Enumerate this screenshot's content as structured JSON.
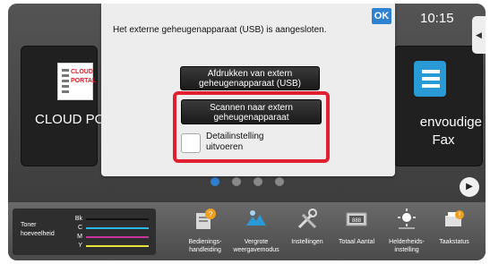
{
  "status": {
    "time": "10:15"
  },
  "home": {
    "tiles": [
      {
        "label": "CLOUD POR",
        "logo_text_1": "CLOUD",
        "logo_text_2": "PORTAL"
      },
      {
        "label": "envoudige Fax"
      }
    ],
    "pager": {
      "pages": 4,
      "active_index": 0
    },
    "next_icon": "play-right-icon",
    "side_icon": "arrow-left-icon"
  },
  "dialog": {
    "ok_label": "OK",
    "message": "Het externe geheugenapparaat (USB) is aangesloten.",
    "print_button_label": "Afdrukken van extern geheugenapparaat (USB)",
    "scan_button_label": "Scannen naar extern geheugenapparaat",
    "detail_checkbox_label": "Detailinstelling uitvoeren",
    "detail_checked": false,
    "highlight_color": "#e02030"
  },
  "bottom_bar": {
    "toner": {
      "label": "Toner hoeveelheid",
      "channels": [
        {
          "name": "Bk",
          "color": "#111111"
        },
        {
          "name": "C",
          "color": "#2ab8e8"
        },
        {
          "name": "M",
          "color": "#c8329a"
        },
        {
          "name": "Y",
          "color": "#e8e03a"
        }
      ]
    },
    "tools": [
      {
        "label": "Bedienings-handleiding",
        "icon": "manual-icon"
      },
      {
        "label": "Vergrote weergavemodus",
        "icon": "magnify-view-icon"
      },
      {
        "label": "Instellingen",
        "icon": "settings-tools-icon"
      },
      {
        "label": "Totaal Aantal",
        "icon": "counter-icon"
      },
      {
        "label": "Helderheids-instelling",
        "icon": "brightness-icon"
      },
      {
        "label": "Taakstatus",
        "icon": "job-status-icon"
      }
    ]
  }
}
